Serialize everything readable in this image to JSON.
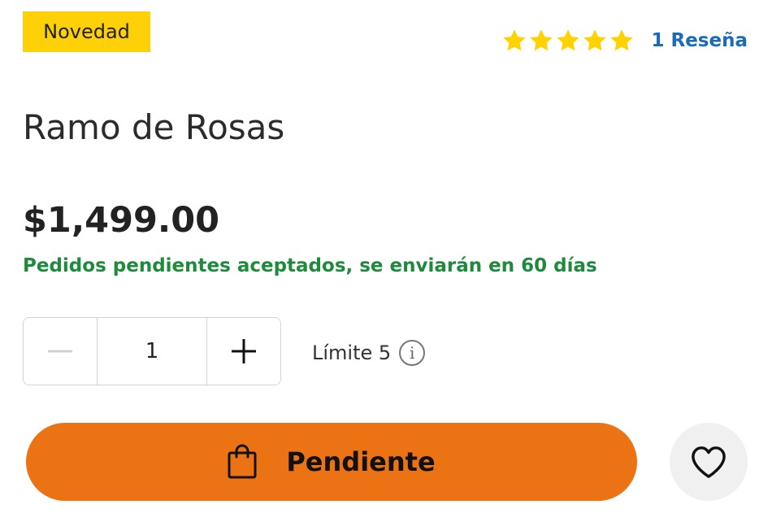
{
  "badge": {
    "label": "Novedad"
  },
  "rating": {
    "stars": 5,
    "max": 5,
    "reviews_label": "1 Reseña"
  },
  "product": {
    "title": "Ramo de Rosas",
    "price": "$1,499.00",
    "availability": "Pedidos pendientes aceptados, se enviarán en 60 días"
  },
  "quantity": {
    "value": "1",
    "limit_label": "Límite 5"
  },
  "cta": {
    "label": "Pendiente"
  },
  "icons": {
    "star": "star-icon",
    "info": "info-icon",
    "minus": "minus-icon",
    "plus": "plus-icon",
    "bag": "shopping-bag-icon",
    "heart": "heart-icon"
  },
  "colors": {
    "badge": "#FDD008",
    "star": "#FFD200",
    "link": "#1A6BB8",
    "availability": "#1E8A3C",
    "cta": "#EB7314",
    "fav_bg": "#F0F0F0"
  }
}
